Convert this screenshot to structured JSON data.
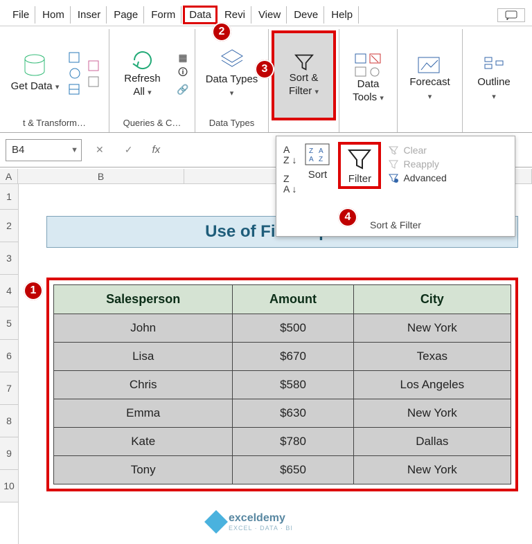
{
  "tabs": {
    "file": "File",
    "home": "Hom",
    "insert": "Inser",
    "page": "Page",
    "formulas": "Form",
    "data": "Data",
    "review": "Revi",
    "view": "View",
    "developer": "Deve",
    "help": "Help"
  },
  "ribbon": {
    "get_data": "Get Data",
    "group_transform": "t & Transform…",
    "refresh_all": "Refresh All",
    "group_queries": "Queries & C…",
    "data_types": "Data Types",
    "group_datatypes": "Data Types",
    "sort_filter": "Sort & Filter",
    "data_tools": "Data Tools",
    "forecast": "Forecast",
    "outline": "Outline"
  },
  "formula_bar": {
    "cell_ref": "B4",
    "fx": "fx"
  },
  "dropdown": {
    "sort": "Sort",
    "filter": "Filter",
    "clear": "Clear",
    "reapply": "Reapply",
    "advanced": "Advanced",
    "group_label": "Sort & Filter"
  },
  "annotations": {
    "a1": "1",
    "a2": "2",
    "a3": "3",
    "a4": "4"
  },
  "columns": {
    "A": "A",
    "B": "B"
  },
  "rows": {
    "r1": "1",
    "r2": "2",
    "r3": "3",
    "r4": "4",
    "r5": "5",
    "r6": "6",
    "r7": "7",
    "r8": "8",
    "r9": "9",
    "r10": "10"
  },
  "sheet": {
    "title": "Use of Filter Option",
    "headers": {
      "salesperson": "Salesperson",
      "amount": "Amount",
      "city": "City"
    },
    "data": [
      {
        "salesperson": "John",
        "amount": "$500",
        "city": "New York"
      },
      {
        "salesperson": "Lisa",
        "amount": "$670",
        "city": "Texas"
      },
      {
        "salesperson": "Chris",
        "amount": "$580",
        "city": "Los Angeles"
      },
      {
        "salesperson": "Emma",
        "amount": "$630",
        "city": "New York"
      },
      {
        "salesperson": "Kate",
        "amount": "$780",
        "city": "Dallas"
      },
      {
        "salesperson": "Tony",
        "amount": "$650",
        "city": "New York"
      }
    ]
  },
  "watermark": {
    "brand": "exceldemy",
    "sub": "EXCEL · DATA · BI"
  }
}
